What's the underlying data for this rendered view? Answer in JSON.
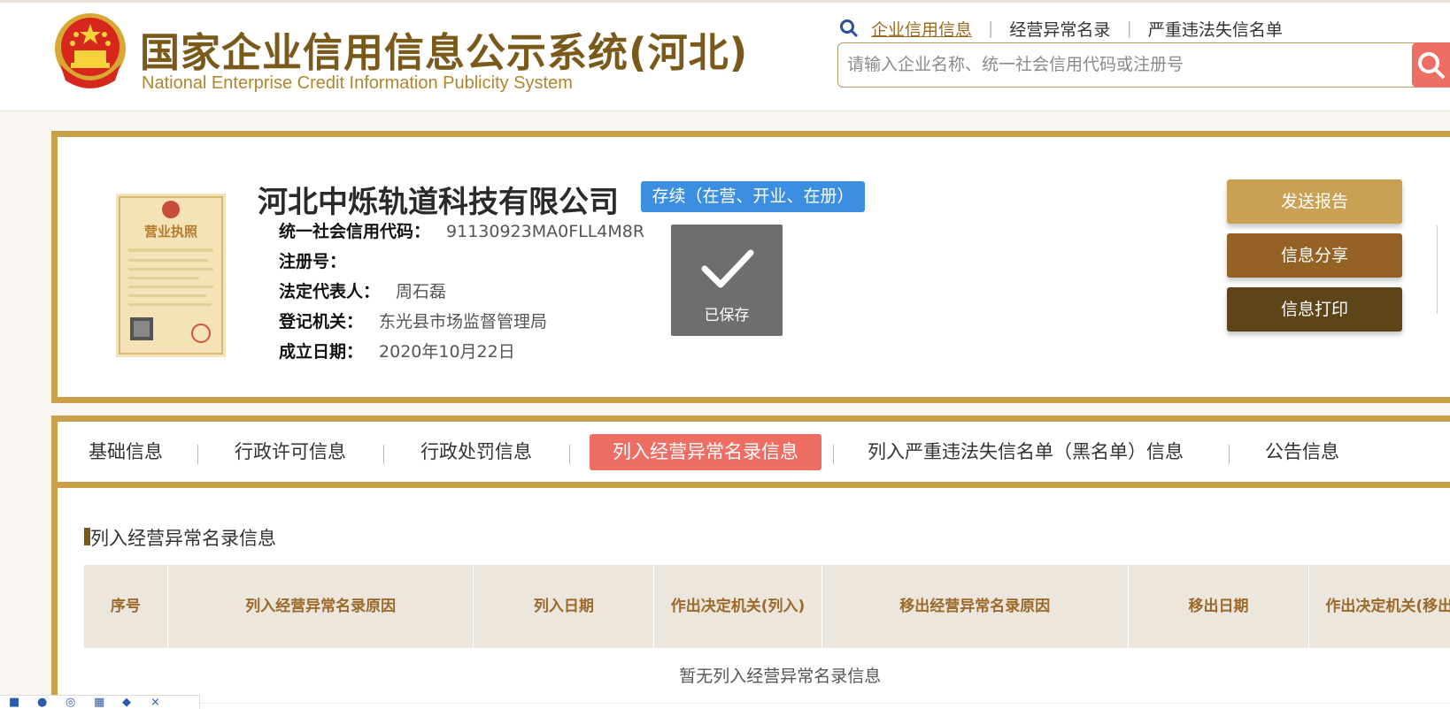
{
  "header": {
    "title_cn": "国家企业信用信息公示系统(河北)",
    "title_en": "National Enterprise Credit Information Publicity System",
    "nav": [
      {
        "label": "企业信用信息"
      },
      {
        "label": "经营异常名录"
      },
      {
        "label": "严重违法失信名单"
      }
    ],
    "search_placeholder": "请输入企业名称、统一社会信用代码或注册号"
  },
  "company": {
    "name": "河北中烁轨道科技有限公司",
    "status": "存续（在营、开业、在册）",
    "fields": [
      {
        "key": "统一社会信用代码：",
        "value": "91130923MA0FLL4M8R"
      },
      {
        "key": "注册号：",
        "value": ""
      },
      {
        "key": "法定代表人：",
        "value": "周石磊"
      },
      {
        "key": "登记机关：",
        "value": "东光县市场监督管理局"
      },
      {
        "key": "成立日期：",
        "value": "2020年10月22日"
      }
    ],
    "saved_label": "已保存",
    "license_text": "营业执照"
  },
  "actions": [
    {
      "label": "发送报告",
      "color": "#c9a054"
    },
    {
      "label": "信息分享",
      "color": "#956226"
    },
    {
      "label": "信息打印",
      "color": "#5e4519"
    }
  ],
  "tabs": [
    {
      "label": "基础信息"
    },
    {
      "label": "行政许可信息"
    },
    {
      "label": "行政处罚信息"
    },
    {
      "label": "列入经营异常名录信息"
    },
    {
      "label": "列入严重违法失信名单（黑名单）信息"
    },
    {
      "label": "公告信息"
    }
  ],
  "section": {
    "title": "列入经营异常名录信息",
    "columns": [
      "序号",
      "列入经营异常名录原因",
      "列入日期",
      "作出决定机关(列入)",
      "移出经营异常名录原因",
      "移出日期",
      "作出决定机关(移出)"
    ],
    "empty_text": "暂无列入经营异常名录信息"
  },
  "colors": {
    "accent": "#c9a047",
    "active_tab": "#ef6e64",
    "status_badge": "#3c8fe0"
  }
}
